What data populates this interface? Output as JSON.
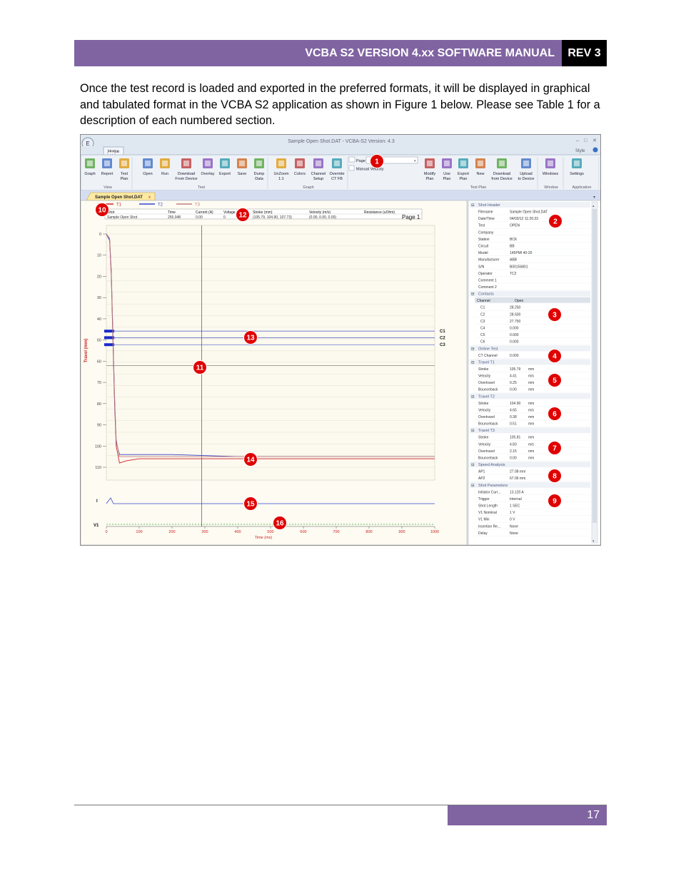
{
  "header": {
    "title": "VCBA S2 VERSION 4.xx SOFTWARE MANUAL",
    "rev": "REV 3"
  },
  "intro_text": "Once the test record is loaded and exported in the preferred formats, it will be displayed in graphical and tabulated format in the VCBA S2 application as shown in Figure 1 below. Please see Table 1 for a description of each numbered section.",
  "footer": {
    "page_number": "17"
  },
  "app": {
    "window_title": "Sample Open Shot.DAT - VCBA-S2 Version: 4.3",
    "app_button": "E",
    "style_label": "Style",
    "ribbon_tab": "Home",
    "ribbon_tab_key": "H",
    "ribbon_groups": [
      {
        "label": "View",
        "buttons": [
          "Graph",
          "Report",
          "Test\nPlan"
        ]
      },
      {
        "label": "Test",
        "buttons": [
          "Open",
          "Run",
          "Download\nFrom Device",
          "Overlay",
          "Export",
          "Save",
          "Dump\nData"
        ]
      },
      {
        "label": "Graph",
        "buttons": [
          "UnZoom\n1:1",
          "Colors",
          "Channel\nSetup",
          "Override\nCT FB"
        ]
      },
      {
        "label": "Test Plan",
        "buttons": [
          "Modify\nPlan",
          "Use\nPlan",
          "Export\nPlan",
          "New",
          "Download\nfrom Device",
          "Upload\nto Device"
        ]
      },
      {
        "label": "Window",
        "buttons": [
          "Windows"
        ]
      },
      {
        "label": "Application",
        "buttons": [
          "Settings"
        ]
      }
    ],
    "page_label": "Page",
    "manual_velocity_label": "Manual Velocity",
    "doc_tab": "Sample Open Shot.DAT",
    "legend": [
      "T1",
      "T2",
      "T3"
    ],
    "info_table": {
      "headers": [
        "Shot",
        "Time",
        "Current (A)",
        "Voltage",
        "Stroke (mm)",
        "Velocity (m/s)",
        "Resistance (uOhm)"
      ],
      "values": [
        "Sample Open Shot",
        "255.048",
        "0.00",
        "0",
        "(105.79, 104.90, 107.73)",
        "(0.00, 0.00, 0.00)",
        ""
      ]
    },
    "page_indicator": "Page 1",
    "channel_labels": [
      "C1",
      "C2",
      "C3"
    ],
    "bottom_labels": [
      "I",
      "V1"
    ],
    "callouts": [
      "1",
      "2",
      "3",
      "4",
      "5",
      "6",
      "7",
      "8",
      "9",
      "10",
      "11",
      "12",
      "13",
      "14",
      "15",
      "16"
    ],
    "properties": [
      {
        "section": "Shot Header",
        "rows": [
          [
            "Filename",
            "Sample Open Shot.DAT"
          ],
          [
            "Date/Time",
            "04/03/12 11:26:33"
          ],
          [
            "Test",
            "OPEN"
          ],
          [
            "Company",
            ""
          ],
          [
            "Station",
            "BCK"
          ],
          [
            "Circuit",
            "BB"
          ],
          [
            "Model",
            "145PMI 40-20"
          ],
          [
            "Manufacturer",
            "ABB"
          ],
          [
            "S/N",
            "B00156801"
          ],
          [
            "Operator",
            "TC2"
          ],
          [
            "Comment 1",
            ""
          ],
          [
            "Comment 2",
            ""
          ]
        ]
      },
      {
        "section": "Contacts",
        "table_header": [
          "Channel",
          "Open"
        ],
        "rows": [
          [
            "C1",
            "28.250"
          ],
          [
            "C2",
            "28.500"
          ],
          [
            "C3",
            "27.750"
          ],
          [
            "C4",
            "0.000"
          ],
          [
            "C5",
            "0.000"
          ],
          [
            "C6",
            "0.000"
          ]
        ]
      },
      {
        "section": "Online Test",
        "rows": [
          [
            "CT Channel",
            "0.000"
          ]
        ]
      },
      {
        "section": "Travel T1",
        "rows": [
          [
            "Stroke",
            "105.79",
            "mm"
          ],
          [
            "Velocity",
            "4.41",
            "m/s"
          ],
          [
            "Overtravel",
            "0.25",
            "mm"
          ],
          [
            "Bounceback",
            "0.00",
            "mm"
          ]
        ]
      },
      {
        "section": "Travel T2",
        "rows": [
          [
            "Stroke",
            "104.90",
            "mm"
          ],
          [
            "Velocity",
            "4.65",
            "m/s"
          ],
          [
            "Overtravel",
            "0.38",
            "mm"
          ],
          [
            "Bounceback",
            "0.51",
            "mm"
          ]
        ]
      },
      {
        "section": "Travel T3",
        "rows": [
          [
            "Stroke",
            "105.81",
            "mm"
          ],
          [
            "Velocity",
            "4.83",
            "m/s"
          ],
          [
            "Overtravel",
            "2.15",
            "mm"
          ],
          [
            "Bounceback",
            "0.00",
            "mm"
          ]
        ]
      },
      {
        "section": "Speed Analysis",
        "rows": [
          [
            "AP1",
            "27.08 mm"
          ],
          [
            "AP2",
            "67.06 mm"
          ]
        ]
      },
      {
        "section": "Shot Parameters",
        "rows": [
          [
            "Initiator Curr...",
            "13.120 A"
          ],
          [
            "Trigger",
            "Internal"
          ],
          [
            "Shot Length",
            "1 SEC"
          ],
          [
            "V1 Nominal",
            "1 V"
          ],
          [
            "V1 Min",
            "0 V"
          ],
          [
            "Insertion Re...",
            "None"
          ],
          [
            "Delay",
            "None"
          ]
        ]
      }
    ]
  },
  "chart_data": {
    "type": "line",
    "xlabel": "Time (ms)",
    "ylabel": "Travel (mm)",
    "xlim": [
      0,
      1000
    ],
    "ylim": [
      0,
      110
    ],
    "x_ticks": [
      "0",
      "100",
      "200",
      "300",
      "400",
      "500",
      "600",
      "700",
      "800",
      "900",
      "1000"
    ],
    "y_ticks": [
      "0",
      "10",
      "20",
      "30",
      "40",
      "50",
      "60",
      "70",
      "80",
      "90",
      "100",
      "110"
    ],
    "series": [
      {
        "name": "T1",
        "color": "#cc2222",
        "x": [
          0,
          10,
          15,
          20,
          25,
          30,
          40,
          60,
          100,
          200,
          400,
          600,
          800,
          1000
        ],
        "y": [
          0,
          3,
          20,
          50,
          80,
          100,
          108,
          107,
          106,
          106,
          106,
          106,
          106,
          106
        ]
      },
      {
        "name": "T2",
        "color": "#3344cc",
        "x": [
          0,
          10,
          15,
          20,
          25,
          30,
          40,
          60,
          100,
          200,
          400,
          600,
          800,
          1000
        ],
        "y": [
          0,
          3,
          18,
          48,
          78,
          98,
          104,
          104,
          104,
          104,
          105,
          105,
          105,
          105
        ]
      },
      {
        "name": "T3",
        "color": "#c08080",
        "x": [
          0,
          10,
          15,
          20,
          25,
          30,
          40,
          60,
          100,
          200,
          400,
          600,
          800,
          1000
        ],
        "y": [
          0,
          2,
          17,
          46,
          76,
          97,
          105,
          105,
          105,
          105,
          105,
          105,
          105,
          105
        ]
      }
    ],
    "contact_levels": [
      {
        "name": "C1",
        "y": 45.8
      },
      {
        "name": "C2",
        "y": 48.9
      },
      {
        "name": "C3",
        "y": 52.2
      }
    ]
  }
}
